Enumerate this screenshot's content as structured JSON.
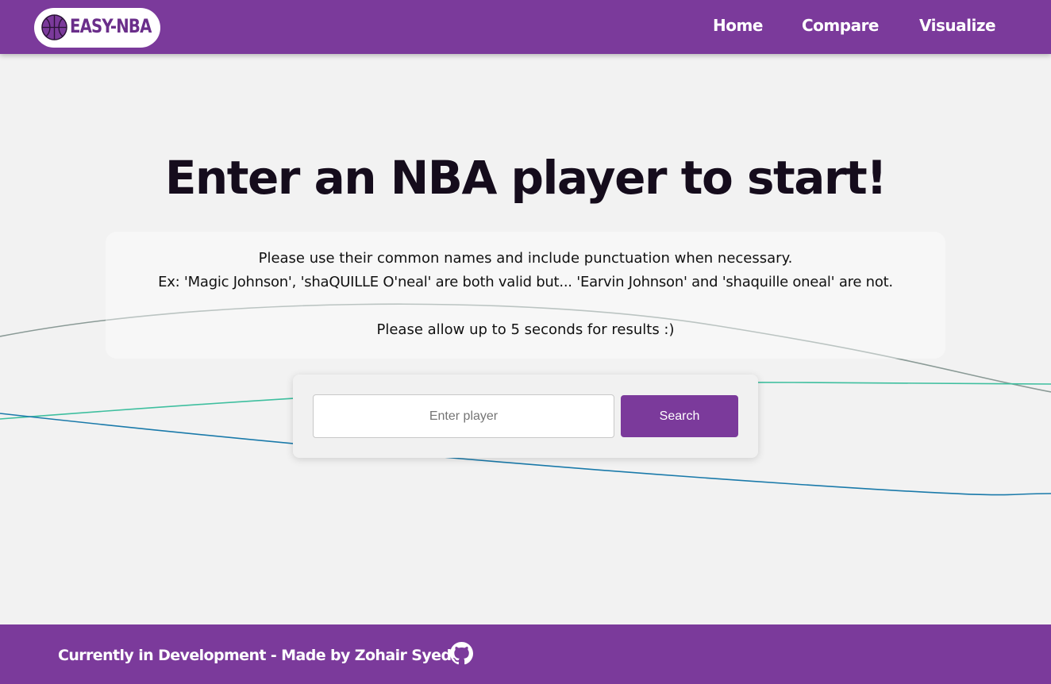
{
  "nav": {
    "logo_text": "EASY-NBA",
    "links": [
      "Home",
      "Compare",
      "Visualize"
    ]
  },
  "main": {
    "title": "Enter an NBA player to start!",
    "info_line1": "Please use their common names and include punctuation when necessary.",
    "info_line2": "Ex: 'Magic Johnson', 'shaQUILLE O'neal' are both valid but... 'Earvin Johnson' and 'shaquille oneal' are not.",
    "info_line3": "Please allow up to 5 seconds for results :)"
  },
  "search": {
    "placeholder": "Enter player",
    "value": "",
    "button_label": "Search"
  },
  "footer": {
    "text": "Currently in Development - Made by Zohair Syed"
  },
  "icons": {
    "logo": "basketball-icon",
    "footer": "github-icon"
  },
  "colors": {
    "brand_purple": "#7b3a9b",
    "background": "#f2f2f2",
    "wave_gray": "#8a9a96",
    "wave_teal": "#3fbf9f",
    "wave_blue": "#1a7aaa"
  }
}
